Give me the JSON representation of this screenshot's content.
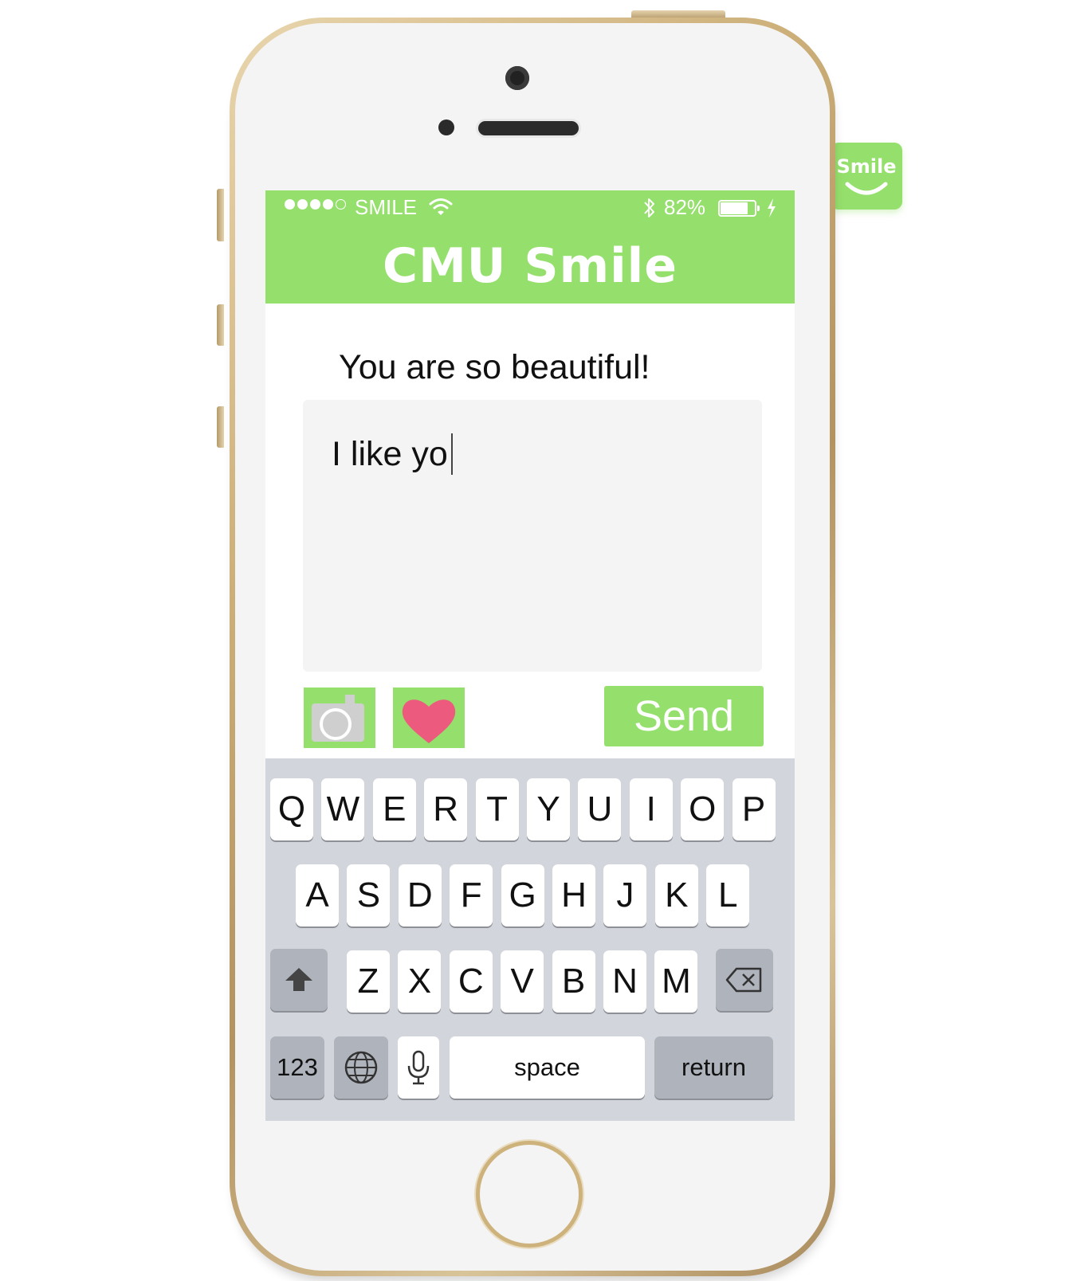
{
  "status_bar": {
    "signal_bars_filled": 4,
    "signal_bars_total": 5,
    "carrier": "SMILE",
    "battery_percent": "82%",
    "battery_level": 0.82,
    "icons": [
      "wifi-icon",
      "bluetooth-icon",
      "battery-icon",
      "charging-icon"
    ]
  },
  "header": {
    "title": "CMU Smile"
  },
  "app_icon": {
    "label": "Smile"
  },
  "main": {
    "message": "You are so beautiful!",
    "reply_text": "I like yo",
    "camera_icon": "camera-icon",
    "heart_icon": "heart-icon",
    "send_label": "Send"
  },
  "keyboard": {
    "row1": [
      "Q",
      "W",
      "E",
      "R",
      "T",
      "Y",
      "U",
      "I",
      "O",
      "P"
    ],
    "row2": [
      "A",
      "S",
      "D",
      "F",
      "G",
      "H",
      "J",
      "K",
      "L"
    ],
    "row3": [
      "Z",
      "X",
      "C",
      "V",
      "B",
      "N",
      "M"
    ],
    "numbers_label": "123",
    "space_label": "space",
    "return_label": "return",
    "special_icons": [
      "shift-icon",
      "delete-icon",
      "globe-icon",
      "microphone-icon"
    ]
  },
  "colors": {
    "accent_green": "#95df6c",
    "heart_pink": "#ec5b7e",
    "keyboard_bg": "#d2d5db",
    "phone_gold": "#cdb07a"
  }
}
